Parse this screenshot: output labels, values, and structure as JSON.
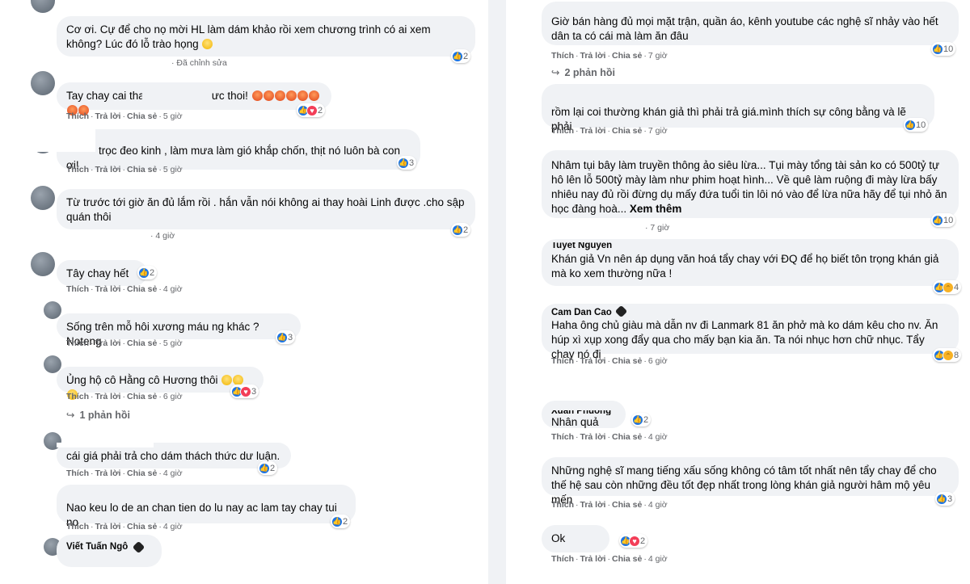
{
  "actions": {
    "like": "Thích",
    "reply": "Trả lời",
    "share": "Chia sẻ",
    "sep": "·"
  },
  "colors": {
    "bubble": "#f0f2f5",
    "meta": "#65676b",
    "like": "#1b74e4",
    "love": "#f33e58"
  },
  "left": {
    "comments": [
      {
        "text": "Cơ ơi. Cự để cho nọ mời HL làm dám khảo rồi xem chương trình có ai xem không? Lúc đó lỗ trào họng",
        "emoji": "smile",
        "meta_time": "Đã chỉnh sửa",
        "react_count": "2",
        "reacts": [
          "like"
        ]
      },
      {
        "text_a": "Tay chay cai thai",
        "text_b": "ưc thoi!",
        "time": "5 giờ",
        "react_count": "2",
        "reacts": [
          "like",
          "love"
        ]
      },
      {
        "text": "trọc đeo kinh , làm mưa làm gió khắp chốn, thịt nó luôn bà con ơi!",
        "time": "5 giờ",
        "react_count": "3",
        "reacts": [
          "like"
        ]
      },
      {
        "text": "Từ trước tới giờ ăn đủ lắm rồi . hắn vẫn nói không ai thay hoài Linh được .cho sập quán thôi",
        "time": "4 giờ",
        "react_count": "2",
        "reacts": [
          "like"
        ]
      },
      {
        "text": "Tây chay hết",
        "time": "4 giờ",
        "react_count": "2",
        "reacts": [
          "like"
        ]
      },
      {
        "text": "Sống trên mỗ hôi xương máu ng khác ? Noteng",
        "time": "5 giờ",
        "react_count": "3",
        "reacts": [
          "like"
        ]
      },
      {
        "text": "Ủng hộ cô Hằng cô Hương thôi",
        "time": "6 giờ",
        "react_count": "3",
        "reacts": [
          "like",
          "love"
        ]
      },
      {
        "text": "cái giá phải trả cho dám thách thức dư luận.",
        "time": "4 giờ",
        "react_count": "2",
        "reacts": [
          "like"
        ]
      },
      {
        "text": "Nao keu lo de an chan tien do lu nay ac lam tay chay tui no",
        "time": "4 giờ",
        "react_count": "2",
        "reacts": [
          "like"
        ]
      }
    ],
    "replies_link": "1 phản hồi",
    "last_author": "Viết Tuấn Ngô"
  },
  "right": {
    "comments": [
      {
        "text": "Giờ bán hàng đủ mọi mặt trận, quần áo, kênh youtube các nghệ sĩ nhảy vào hết dân ta có cái mà làm ăn đâu",
        "time": "7 giờ",
        "react_count": "10",
        "reacts": [
          "like"
        ]
      },
      {
        "text_a": "rồm lại coi thường",
        "text_b": "khán giả thì phải trả giá.mình thích sự công bằng và lẽ phải",
        "time": "7 giờ",
        "react_count": "10",
        "reacts": [
          "like"
        ]
      },
      {
        "text": "Nhâm tụi bây làm truyền thông ảo siêu lừa... Tụi mày tổng tài sản ko có 500tỷ tự hô lên lỗ 500tỷ mày làm như phim hoạt hình... Về quê làm ruộng đi mày lừa bấy nhiêu nay đủ rồi đừng dụ mấy đứa tuổi tin lôi nó vào để lừa nữa hãy để tụi nhỏ ăn học đàng hoà...",
        "see_more": "Xem thêm",
        "time": "7 giờ",
        "react_count": "10",
        "reacts": [
          "like"
        ]
      },
      {
        "author": "Tuyet Nguyen",
        "text": "Khán giả Vn nên áp dụng văn hoá tẩy chay với ĐQ để họ biết tôn trọng khán giả mà ko xem thường nữa !",
        "react_count": "4",
        "reacts": [
          "like",
          "haha"
        ]
      },
      {
        "author": "Cam Dan Cao",
        "text": "Haha ông chủ giàu mà dẫn nv đi Lanmark 81 ăn phở mà ko dám kêu cho nv. Ăn húp xì xụp xong đẩy qua cho mấy bạn kia ăn. Ta nói nhục hơn chữ nhục. Tẩy chay nó đi",
        "time": "6 giờ",
        "react_count": "8",
        "reacts": [
          "like",
          "haha"
        ]
      },
      {
        "author": "Xuan Phuong",
        "text": "Nhân quả",
        "time": "4 giờ",
        "react_count": "2",
        "reacts": [
          "like"
        ]
      },
      {
        "text": "Những nghệ sĩ mang tiếng xấu sống không có tâm tốt nhất nên tẩy chay để cho thế hệ sau còn những đều tốt đẹp nhất trong lòng khán giả người hâm mộ yêu mến",
        "time": "4 giờ",
        "react_count": "3",
        "reacts": [
          "like"
        ]
      },
      {
        "text": "Ok",
        "time": "4 giờ",
        "react_count": "2",
        "reacts": [
          "like",
          "love"
        ]
      }
    ],
    "replies_link": "2 phản hồi"
  }
}
